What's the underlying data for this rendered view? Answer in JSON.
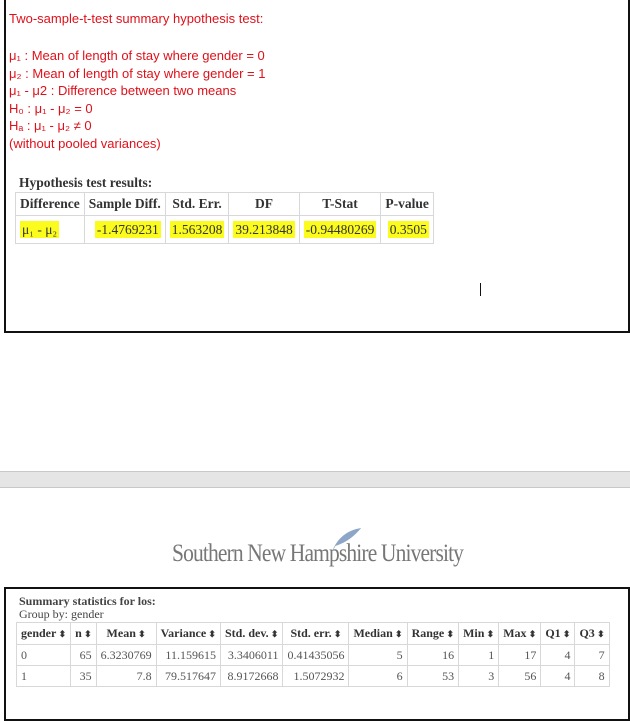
{
  "top": {
    "title": "Two-sample-t-test summary hypothesis test:",
    "lines": [
      "μ₁ : Mean of length of stay where gender = 0",
      "μ₂ : Mean of length of stay where gender = 1",
      "μ₁ - μ2 : Difference between two means",
      "H₀ : μ₁ - μ₂ = 0",
      "Hₐ : μ₁ - μ₂ ≠ 0",
      "(without pooled variances)"
    ],
    "results_heading": "Hypothesis test results:",
    "columns": [
      "Difference",
      "Sample Diff.",
      "Std. Err.",
      "DF",
      "T-Stat",
      "P-value"
    ],
    "row": [
      "μ₁ - μ₂",
      "-1.4769231",
      "1.563208",
      "39.213848",
      "-0.94480269",
      "0.3505"
    ],
    "highlight_color": "#fbfb1e",
    "text_color": "#e0101a"
  },
  "logo": {
    "text": "Southern New Hampshire University"
  },
  "summary": {
    "heading": "Summary statistics for los:",
    "group_by": "Group by: gender",
    "sort_icon": "sort-icon",
    "columns": [
      "gender",
      "n",
      "Mean",
      "Variance",
      "Std. dev.",
      "Std. err.",
      "Median",
      "Range",
      "Min",
      "Max",
      "Q1",
      "Q3"
    ],
    "rows": [
      [
        "0",
        "65",
        "6.3230769",
        "11.159615",
        "3.3406011",
        "0.41435056",
        "5",
        "16",
        "1",
        "17",
        "4",
        "7"
      ],
      [
        "1",
        "35",
        "7.8",
        "79.517647",
        "8.9172668",
        "1.5072932",
        "6",
        "53",
        "3",
        "56",
        "4",
        "8"
      ]
    ]
  }
}
